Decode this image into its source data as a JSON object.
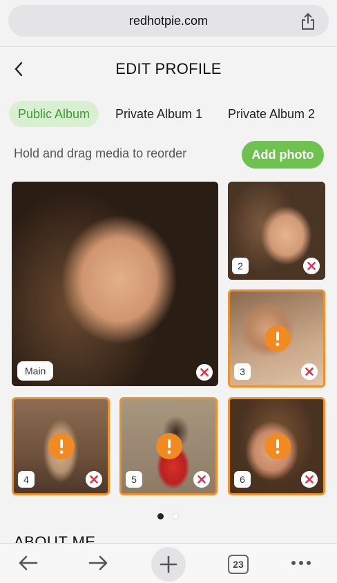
{
  "browser": {
    "url": "redhotpie.com",
    "tabs_count": "23"
  },
  "header": {
    "title": "EDIT PROFILE"
  },
  "album_tabs": [
    {
      "label": "Public Album",
      "active": true
    },
    {
      "label": "Private Album 1",
      "active": false
    },
    {
      "label": "Private Album 2",
      "active": false
    }
  ],
  "hint": "Hold and drag media to reorder",
  "add_photo_label": "Add photo",
  "photos": [
    {
      "badge": "Main",
      "pending": false
    },
    {
      "badge": "2",
      "pending": false
    },
    {
      "badge": "3",
      "pending": true
    },
    {
      "badge": "4",
      "pending": true
    },
    {
      "badge": "5",
      "pending": true
    },
    {
      "badge": "6",
      "pending": true
    }
  ],
  "pager": {
    "pages": 2,
    "current": 1
  },
  "section_heading": "ABOUT ME",
  "colors": {
    "accent_green": "#6fc24f",
    "tab_active_bg": "#d9efd2",
    "pending_orange": "#f0902a",
    "remove_red": "#e0344a"
  }
}
